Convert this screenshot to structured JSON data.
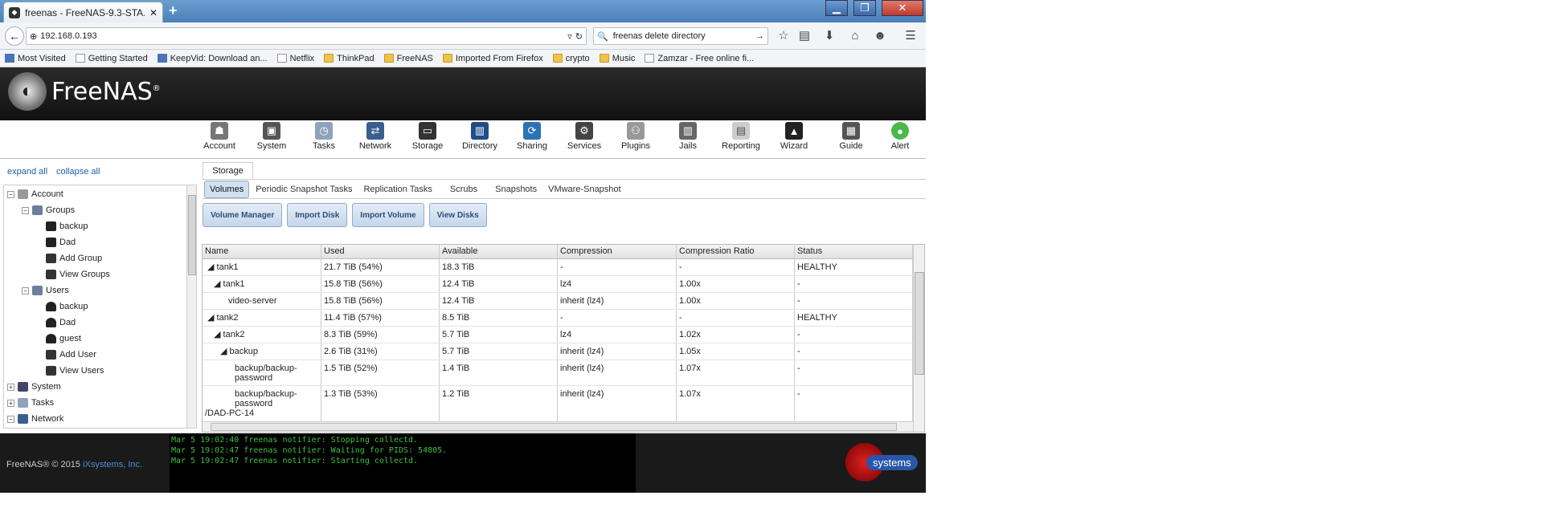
{
  "browser": {
    "tab_title": "freenas - FreeNAS-9.3-STA...",
    "url": "192.168.0.193",
    "search": "freenas delete directory",
    "bookmarks": [
      "Most Visited",
      "Getting Started",
      "KeepVid: Download an...",
      "Netflix",
      "ThinkPad",
      "FreeNAS",
      "Imported From Firefox",
      "crypto",
      "Music",
      "Zamzar - Free online fi..."
    ]
  },
  "app": {
    "logo_text": "FreeNAS",
    "logo_mark": "®"
  },
  "toolbar": [
    "Account",
    "System",
    "Tasks",
    "Network",
    "Storage",
    "Directory",
    "Sharing",
    "Services",
    "Plugins",
    "Jails",
    "Reporting",
    "Wizard",
    "Guide",
    "Alert"
  ],
  "tree_controls": {
    "expand": "expand all",
    "collapse": "collapse all"
  },
  "tree": [
    {
      "label": "Account",
      "level": 0,
      "toggle": "−"
    },
    {
      "label": "Groups",
      "level": 1,
      "toggle": "−"
    },
    {
      "label": "backup",
      "level": 2
    },
    {
      "label": "Dad",
      "level": 2
    },
    {
      "label": "Add Group",
      "level": 2
    },
    {
      "label": "View Groups",
      "level": 2
    },
    {
      "label": "Users",
      "level": 1,
      "toggle": "−"
    },
    {
      "label": "backup",
      "level": 2
    },
    {
      "label": "Dad",
      "level": 2
    },
    {
      "label": "guest",
      "level": 2
    },
    {
      "label": "Add User",
      "level": 2
    },
    {
      "label": "View Users",
      "level": 2
    },
    {
      "label": "System",
      "level": 0,
      "toggle": "+"
    },
    {
      "label": "Tasks",
      "level": 0,
      "toggle": "+"
    },
    {
      "label": "Network",
      "level": 0,
      "toggle": "−"
    }
  ],
  "storage": {
    "tab": "Storage",
    "subtabs": [
      "Volumes",
      "Periodic Snapshot Tasks",
      "Replication Tasks",
      "Scrubs",
      "Snapshots",
      "VMware-Snapshot"
    ],
    "buttons": [
      "Volume Manager",
      "Import Disk",
      "Import Volume",
      "View Disks"
    ],
    "columns": [
      "Name",
      "Used",
      "Available",
      "Compression",
      "Compression Ratio",
      "Status"
    ],
    "rows": [
      {
        "name": "tank1",
        "arrow": "◢",
        "used": "21.7 TiB (54%)",
        "avail": "18.3 TiB",
        "comp": "-",
        "ratio": "-",
        "status": "HEALTHY"
      },
      {
        "name": "tank1",
        "arrow": "◢",
        "used": "15.8 TiB (56%)",
        "avail": "12.4 TiB",
        "comp": "lz4",
        "ratio": "1.00x",
        "status": "-"
      },
      {
        "name": "video-server",
        "arrow": "",
        "used": "15.8 TiB (56%)",
        "avail": "12.4 TiB",
        "comp": "inherit (lz4)",
        "ratio": "1.00x",
        "status": "-"
      },
      {
        "name": "tank2",
        "arrow": "◢",
        "used": "11.4 TiB (57%)",
        "avail": "8.5 TiB",
        "comp": "-",
        "ratio": "-",
        "status": "HEALTHY"
      },
      {
        "name": "tank2",
        "arrow": "◢",
        "used": "8.3 TiB (59%)",
        "avail": "5.7 TiB",
        "comp": "lz4",
        "ratio": "1.02x",
        "status": "-"
      },
      {
        "name": "backup",
        "arrow": "◢",
        "used": "2.6 TiB (31%)",
        "avail": "5.7 TiB",
        "comp": "inherit (lz4)",
        "ratio": "1.05x",
        "status": "-"
      },
      {
        "name": "backup/backup-password",
        "arrow": "",
        "used": "1.5 TiB (52%)",
        "avail": "1.4 TiB",
        "comp": "inherit (lz4)",
        "ratio": "1.07x",
        "status": "-"
      },
      {
        "name": "backup/backup-password",
        "extra": "/DAD-PC-14",
        "arrow": "",
        "used": "1.3 TiB (53%)",
        "avail": "1.2 TiB",
        "comp": "inherit (lz4)",
        "ratio": "1.07x",
        "status": "-"
      }
    ]
  },
  "console": [
    "Mar  5 19:02:40 freenas notifier: Stopping collectd.",
    "Mar  5 19:02:47 freenas notifier: Waiting for PIDS: 54805.",
    "Mar  5 19:02:47 freenas notifier: Starting collectd."
  ],
  "footer": {
    "copyright": "FreeNAS® © 2015 ",
    "company": "iXsystems, Inc.",
    "brand": "systems"
  }
}
